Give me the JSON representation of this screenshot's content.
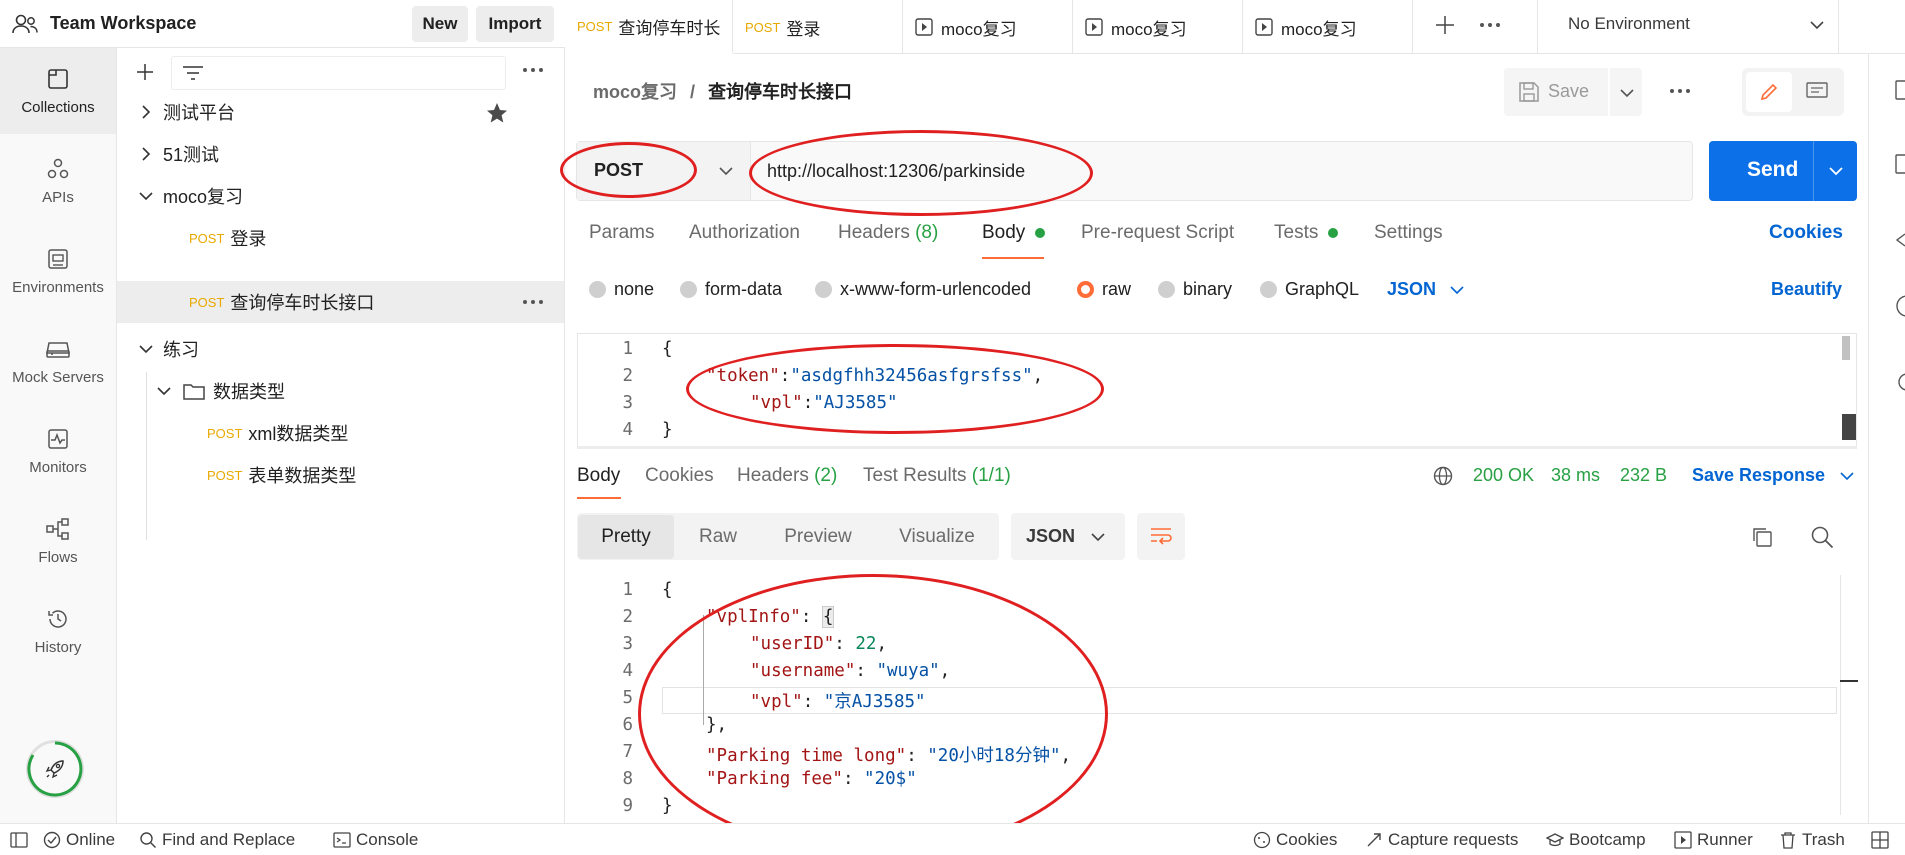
{
  "workspace": {
    "title": "Team Workspace",
    "new_label": "New",
    "import_label": "Import"
  },
  "rail": [
    {
      "label": "Collections",
      "icon": "collections-icon",
      "active": true
    },
    {
      "label": "APIs",
      "icon": "apis-icon"
    },
    {
      "label": "Environments",
      "icon": "environments-icon"
    },
    {
      "label": "Mock Servers",
      "icon": "mock-servers-icon"
    },
    {
      "label": "Monitors",
      "icon": "monitors-icon"
    },
    {
      "label": "Flows",
      "icon": "flows-icon"
    },
    {
      "label": "History",
      "icon": "history-icon"
    }
  ],
  "tree": {
    "items": [
      {
        "label": "测试平台"
      },
      {
        "label": "51测试"
      },
      {
        "label": "moco复习"
      },
      {
        "method": "POST",
        "label": "登录"
      },
      {
        "method": "POST",
        "label": "查询停车时长接口"
      },
      {
        "label": "练习"
      },
      {
        "label": "数据类型"
      },
      {
        "method": "POST",
        "label": "xml数据类型"
      },
      {
        "method": "POST",
        "label": "表单数据类型"
      }
    ]
  },
  "tabs": [
    {
      "method": "POST",
      "label": "查询停车时长"
    },
    {
      "method": "POST",
      "label": "登录"
    },
    {
      "label": "moco复习"
    },
    {
      "label": "moco复习"
    },
    {
      "label": "moco复习"
    }
  ],
  "environment": "No Environment",
  "breadcrumb": {
    "parent": "moco复习",
    "separator": "/",
    "current": "查询停车时长接口"
  },
  "save_label": "Save",
  "request": {
    "method": "POST",
    "url": "http://localhost:12306/parkinside",
    "send_label": "Send"
  },
  "request_tabs": {
    "params": "Params",
    "authorization": "Authorization",
    "headers": "Headers",
    "headers_count": "(8)",
    "body": "Body",
    "prerequest": "Pre-request Script",
    "tests": "Tests",
    "settings": "Settings",
    "cookies": "Cookies"
  },
  "body_types": {
    "none": "none",
    "form_data": "form-data",
    "urlencoded": "x-www-form-urlencoded",
    "raw": "raw",
    "binary": "binary",
    "graphql": "GraphQL",
    "format": "JSON",
    "beautify": "Beautify"
  },
  "request_body": {
    "line_numbers": [
      "1",
      "2",
      "3",
      "4"
    ],
    "open": "{",
    "token_key": "\"token\"",
    "token_value": "\"asdgfhh32456asfgrsfss\"",
    "vpl_key": "\"vpl\"",
    "vpl_value": "\"AJ3585\"",
    "close": "}"
  },
  "response_tabs": {
    "body": "Body",
    "cookies": "Cookies",
    "headers": "Headers",
    "headers_count": "(2)",
    "test_results": "Test Results",
    "test_results_count": "(1/1)"
  },
  "response_meta": {
    "status": "200 OK",
    "time": "38 ms",
    "size": "232 B",
    "save_response": "Save Response"
  },
  "view_modes": {
    "pretty": "Pretty",
    "raw": "Raw",
    "preview": "Preview",
    "visualize": "Visualize",
    "format": "JSON"
  },
  "response_body": {
    "line_numbers": [
      "1",
      "2",
      "3",
      "4",
      "5",
      "6",
      "7",
      "8",
      "9"
    ],
    "open": "{",
    "vplInfo_key": "\"vplInfo\"",
    "userID_key": "\"userID\"",
    "userID_value": "22",
    "username_key": "\"username\"",
    "username_value": "\"wuya\"",
    "vpl_key": "\"vpl\"",
    "vpl_value": "\"京AJ3585\"",
    "inner_close": "},",
    "parking_time_key": "\"Parking time long\"",
    "parking_time_value": "\"20小时18分钟\"",
    "parking_fee_key": "\"Parking fee\"",
    "parking_fee_value": "\"20$\"",
    "close": "}"
  },
  "statusbar": {
    "online": "Online",
    "find_replace": "Find and Replace",
    "console": "Console",
    "cookies": "Cookies",
    "capture": "Capture requests",
    "bootcamp": "Bootcamp",
    "runner": "Runner",
    "trash": "Trash"
  },
  "colors": {
    "accent": "#0265d2",
    "send": "#0c71e9",
    "success": "#27a143",
    "method": "#e8a900",
    "annotation": "#e02020"
  }
}
